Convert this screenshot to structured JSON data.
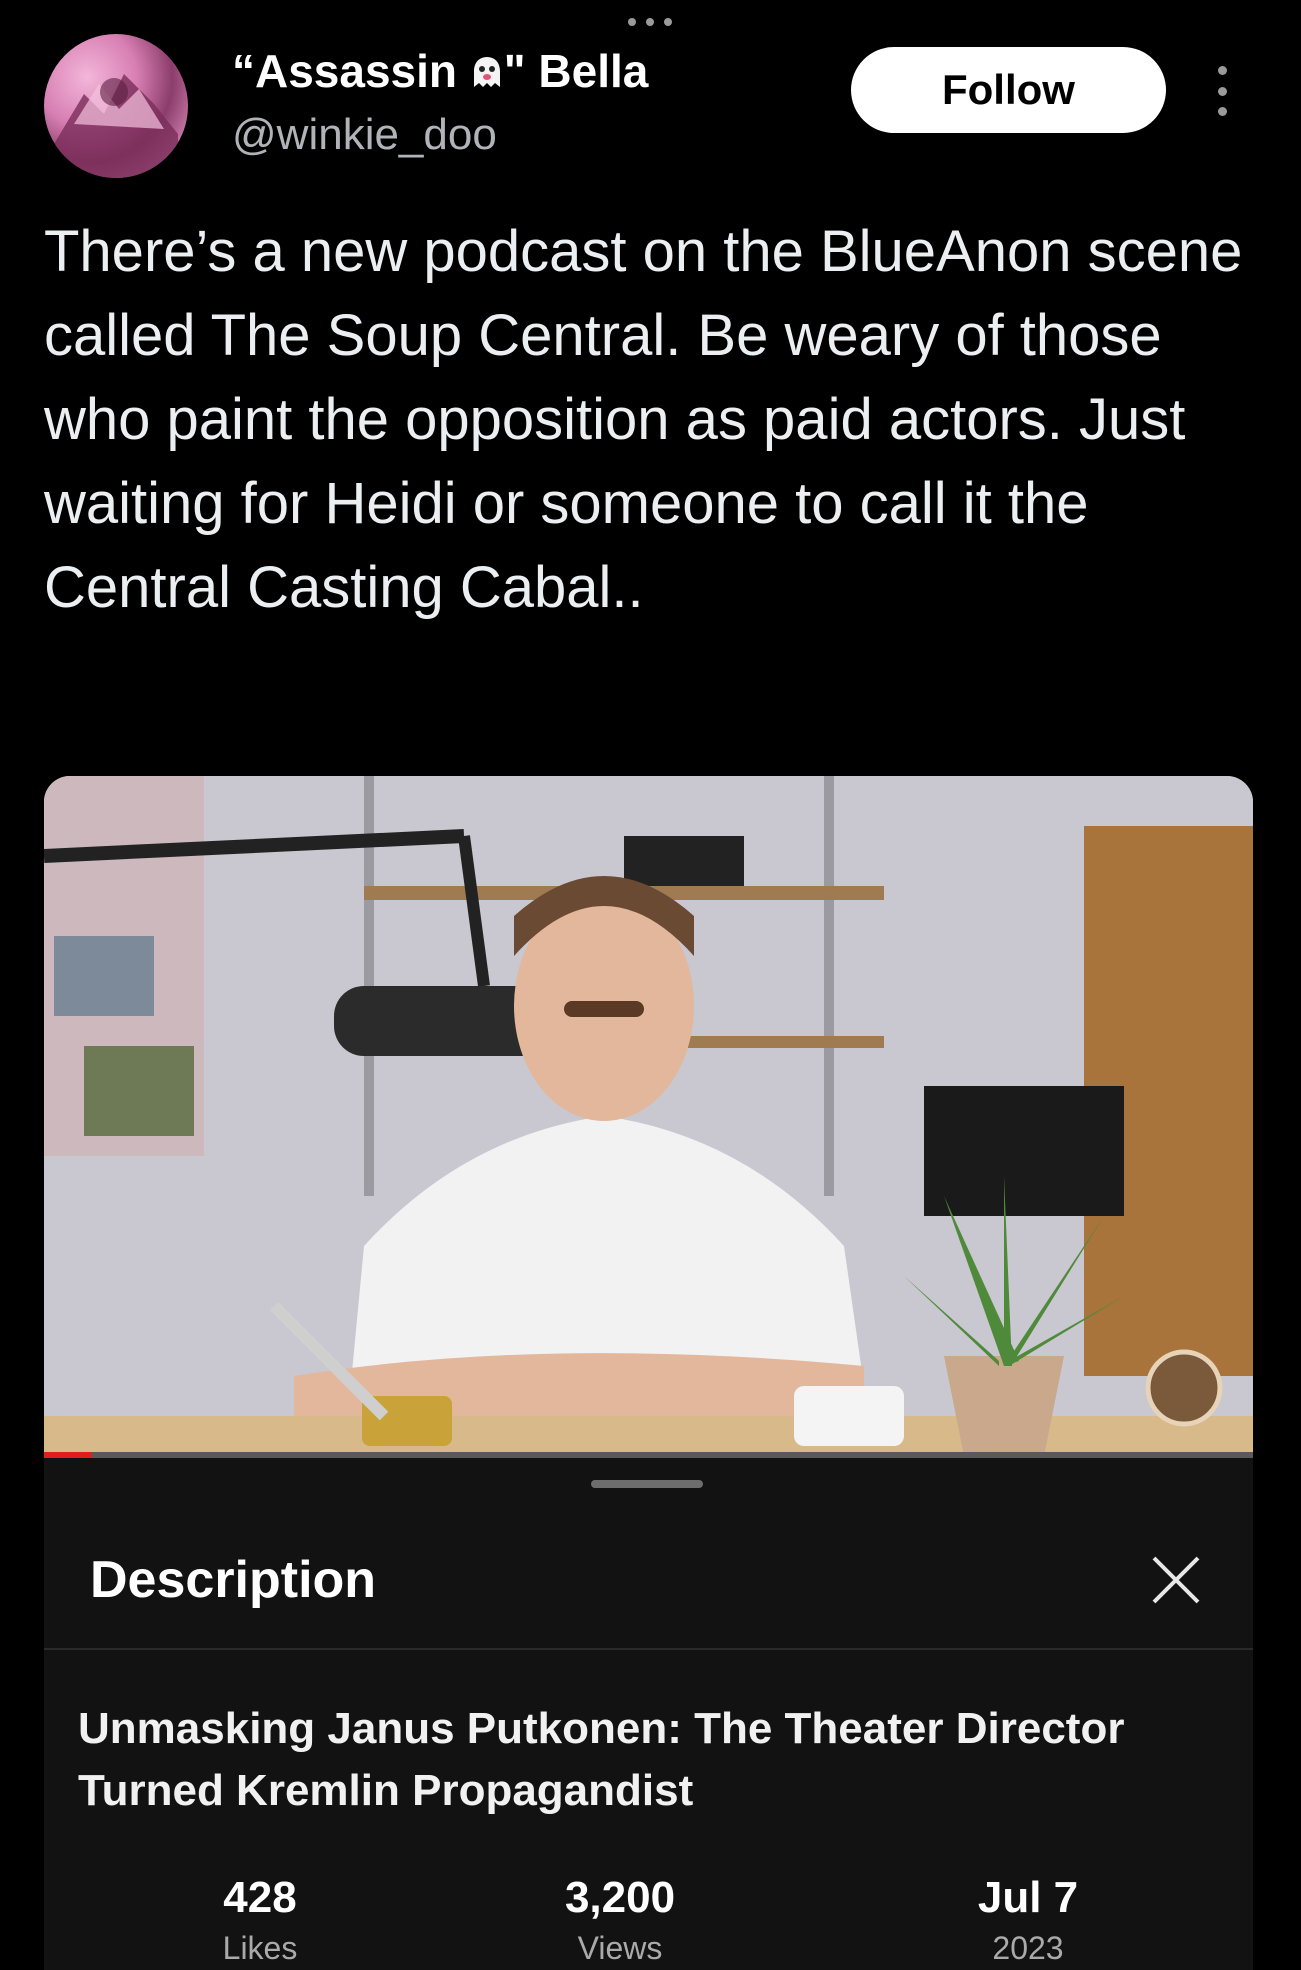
{
  "header": {
    "display_name_prefix": "“Assassin ",
    "display_name_suffix": "\" Bella",
    "handle": "@winkie_doo",
    "follow_label": "Follow"
  },
  "tweet": {
    "text": "There’s a new podcast on the BlueAnon scene called The Soup Central. Be weary of those who paint the opposition as paid actors. Just waiting for Heidi or someone to call it the Central Casting Cabal.."
  },
  "video": {
    "progress_fraction": 0.04,
    "progress_color": "#e01e1e"
  },
  "description_sheet": {
    "title": "Description",
    "video_title": "Unmasking Janus Putkonen: The Theater Director Turned Kremlin Propagandist",
    "stats": [
      {
        "value": "428",
        "label": "Likes"
      },
      {
        "value": "3,200",
        "label": "Views"
      },
      {
        "value": "Jul 7",
        "label": "2023"
      }
    ]
  },
  "icons": {
    "more": "more-vertical-icon",
    "close": "close-icon",
    "ghost": "ghost-emoji-icon"
  }
}
